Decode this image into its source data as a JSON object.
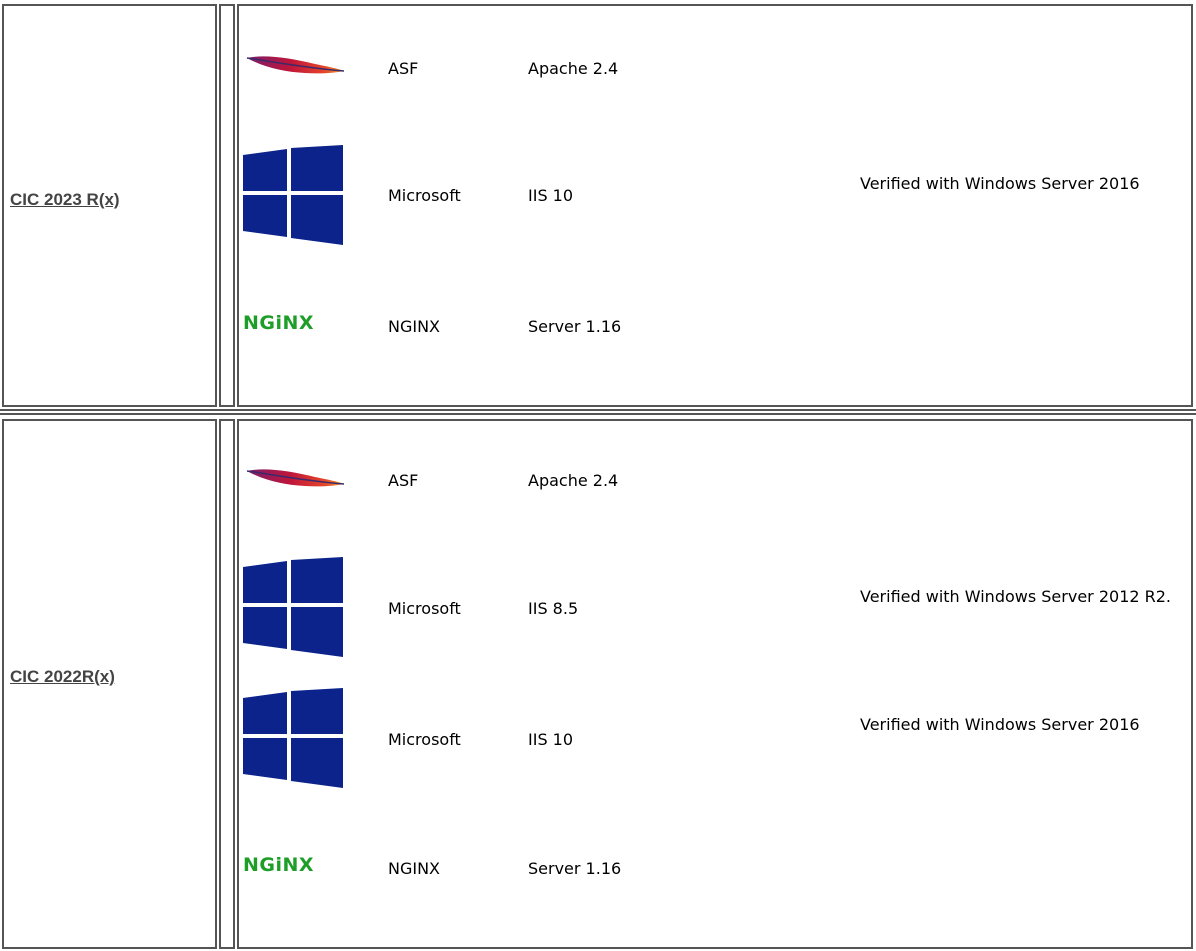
{
  "groups": [
    {
      "version": "CIC 2023 R(x)",
      "rows": [
        {
          "logo": "apache-feather-icon",
          "vendor": "ASF",
          "product": "Apache 2.4",
          "notes": ""
        },
        {
          "logo": "windows-logo-icon",
          "vendor": "Microsoft",
          "product": "IIS 10",
          "notes": "Verified with Windows Server 2016"
        },
        {
          "logo": "nginx-logo",
          "logo_text": "NGiNX",
          "vendor": "NGINX",
          "product": "Server 1.16",
          "notes": ""
        }
      ]
    },
    {
      "version": "CIC 2022R(x)",
      "rows": [
        {
          "logo": "apache-feather-icon",
          "vendor": "ASF",
          "product": "Apache 2.4",
          "notes": ""
        },
        {
          "logo": "windows-logo-icon",
          "vendor": "Microsoft",
          "product": "IIS 8.5",
          "notes": "Verified with Windows Server 2012 R2."
        },
        {
          "logo": "windows-logo-icon",
          "vendor": "Microsoft",
          "product": "IIS 10",
          "notes": "Verified with Windows Server 2016"
        },
        {
          "logo": "nginx-logo",
          "logo_text": "NGiNX",
          "vendor": "NGINX",
          "product": "Server 1.16",
          "notes": ""
        }
      ]
    }
  ],
  "colors": {
    "nginx_green": "#1e9e29",
    "windows_blue": "#0b238a",
    "apache_red": "#c0163a",
    "border": "#555555"
  }
}
